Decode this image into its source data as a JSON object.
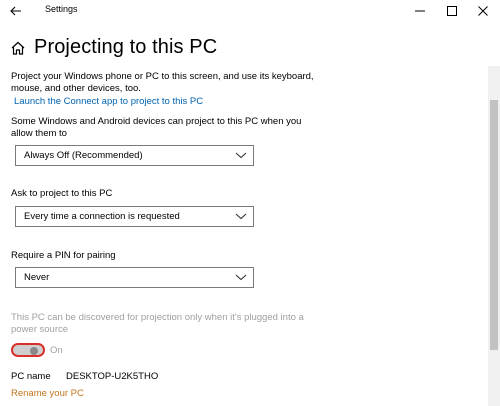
{
  "window": {
    "title": "Settings"
  },
  "header": {
    "title": "Projecting to this PC"
  },
  "intro": {
    "line1": "Project your Windows phone or PC to this screen, and use its keyboard,",
    "line2": "mouse, and other devices, too.",
    "connect_link": "Launch the Connect app to project to this PC"
  },
  "availability": {
    "label_line1": "Some Windows and Android devices can project to this PC when you",
    "label_line2": "allow them to",
    "selected": "Always Off (Recommended)"
  },
  "ask": {
    "label": "Ask to project to this PC",
    "selected": "Every time a connection is requested"
  },
  "pin": {
    "label": "Require a PIN for pairing",
    "selected": "Never"
  },
  "power": {
    "line1": "This PC can be discovered for projection only when it's plugged into a",
    "line2": "power source",
    "toggle_state": "On"
  },
  "pc": {
    "name_label": "PC name",
    "name_value": "DESKTOP-U2K5THO",
    "rename_link": "Rename your PC"
  },
  "colors": {
    "link": "#0063b1",
    "rename_link": "#c2741d",
    "toggle_focus": "#d9302b"
  }
}
